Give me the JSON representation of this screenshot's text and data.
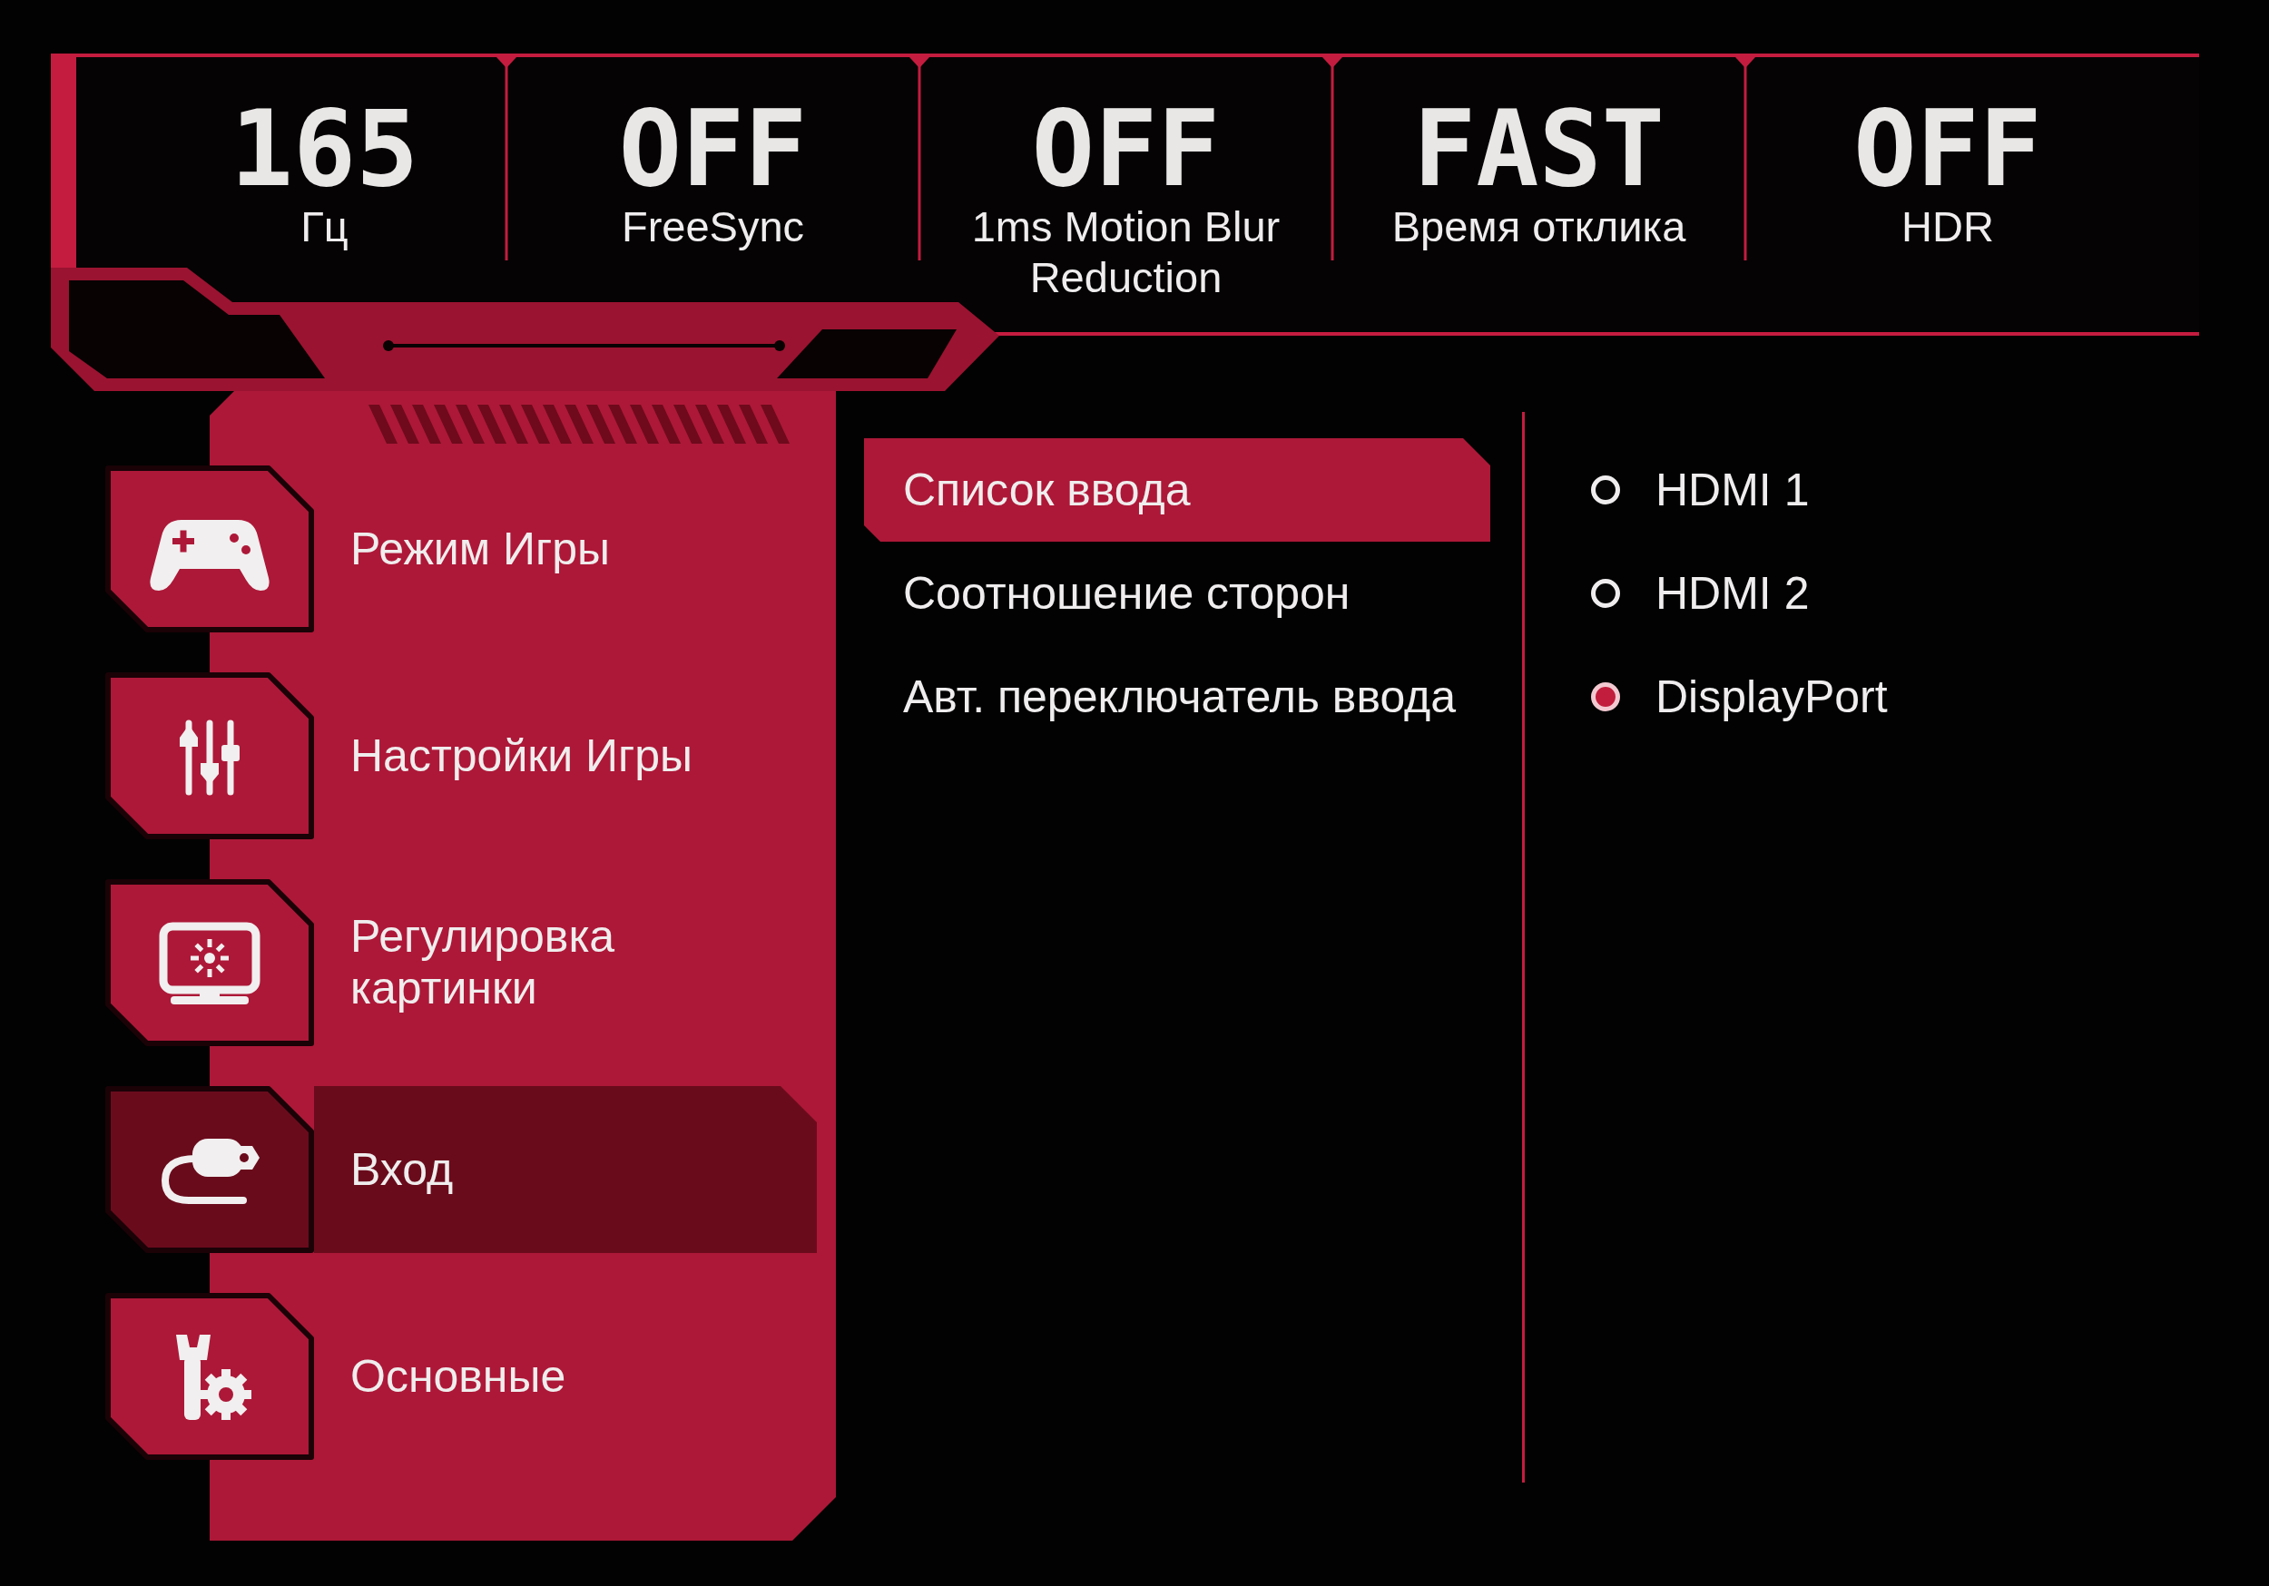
{
  "status_bar": {
    "items": [
      {
        "value": "165",
        "label": "Гц"
      },
      {
        "value": "OFF",
        "label": "FreeSync"
      },
      {
        "value": "OFF",
        "label": "1ms Motion Blur Reduction"
      },
      {
        "value": "FAST",
        "label": "Время отклика"
      },
      {
        "value": "OFF",
        "label": "HDR"
      }
    ]
  },
  "menu": {
    "items": [
      {
        "label": "Режим Игры",
        "selected": false
      },
      {
        "label": "Настройки Игры",
        "selected": false
      },
      {
        "label": "Регулировка картинки",
        "selected": false
      },
      {
        "label": "Вход",
        "selected": true
      },
      {
        "label": "Основные",
        "selected": false
      }
    ]
  },
  "submenu": {
    "items": [
      {
        "label": "Список ввода",
        "selected": true
      },
      {
        "label": "Соотношение сторон",
        "selected": false
      },
      {
        "label": "Авт. переключатель ввода",
        "selected": false
      }
    ]
  },
  "options": {
    "items": [
      {
        "label": "HDMI 1",
        "selected": false
      },
      {
        "label": "HDMI 2",
        "selected": false
      },
      {
        "label": "DisplayPort",
        "selected": true
      }
    ]
  }
}
